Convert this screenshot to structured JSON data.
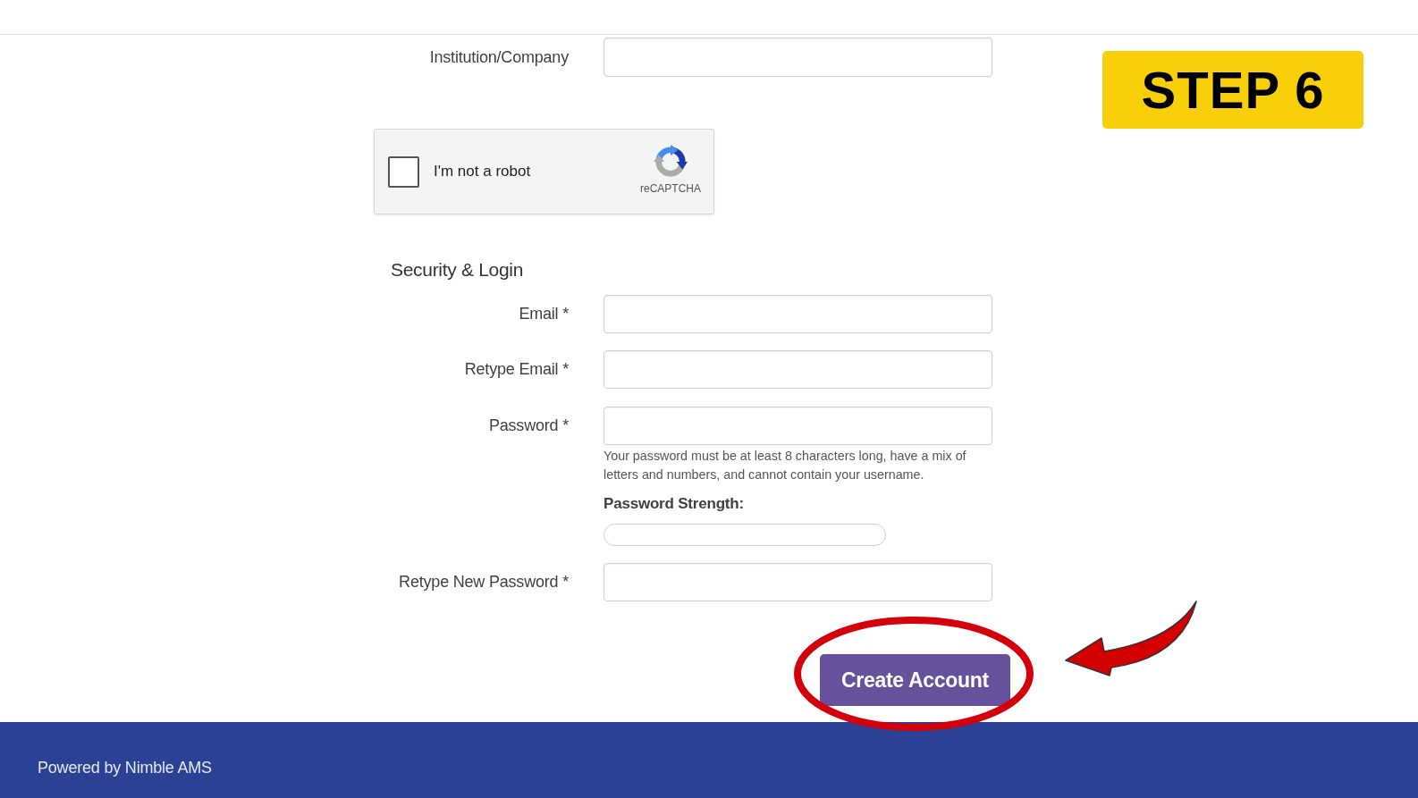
{
  "step_badge": "STEP 6",
  "fields": [
    {
      "label": "Institution/Company"
    }
  ],
  "captcha": {
    "label": "I'm not a robot",
    "checked": false,
    "brand": "reCAPTCHA"
  },
  "security": {
    "title": "Security & Login",
    "fields": [
      {
        "label": "Email *"
      },
      {
        "label": "Retype Email *"
      },
      {
        "label": "Password *",
        "hint": "Your password must be at least 8 characters long, have a mix of letters and numbers, and cannot contain your username.",
        "strength": {
          "label": "Password Strength:"
        }
      },
      {
        "label": "Retype New Password *"
      }
    ]
  },
  "submit_button": "Create Account",
  "footer": "Powered by Nimble AMS"
}
